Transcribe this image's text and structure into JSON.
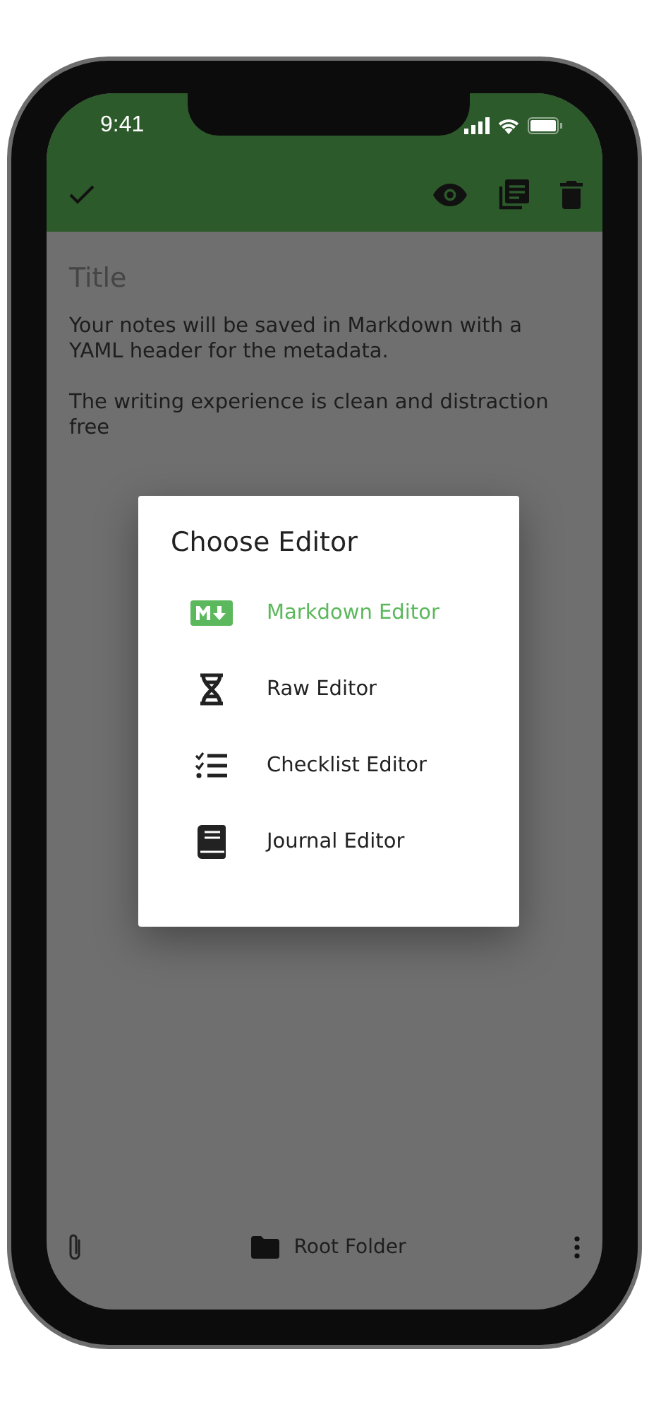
{
  "status_bar": {
    "time": "9:41"
  },
  "toolbar": {
    "actions": [
      {
        "kind": "preview"
      },
      {
        "kind": "view"
      },
      {
        "kind": "delete"
      }
    ]
  },
  "editor": {
    "title_placeholder": "Title",
    "paragraphs": [
      "Your notes will be saved in Markdown with a YAML header for the metadata.",
      "The writing experience is clean and distraction free"
    ]
  },
  "dialog": {
    "title": "Choose Editor",
    "options": [
      {
        "label": "Markdown Editor",
        "kind": "markdown",
        "selected": true
      },
      {
        "label": "Raw Editor",
        "kind": "raw",
        "selected": false
      },
      {
        "label": "Checklist Editor",
        "kind": "checklist",
        "selected": false
      },
      {
        "label": "Journal Editor",
        "kind": "journal",
        "selected": false
      }
    ]
  },
  "bottom_bar": {
    "folder": "Root Folder"
  }
}
